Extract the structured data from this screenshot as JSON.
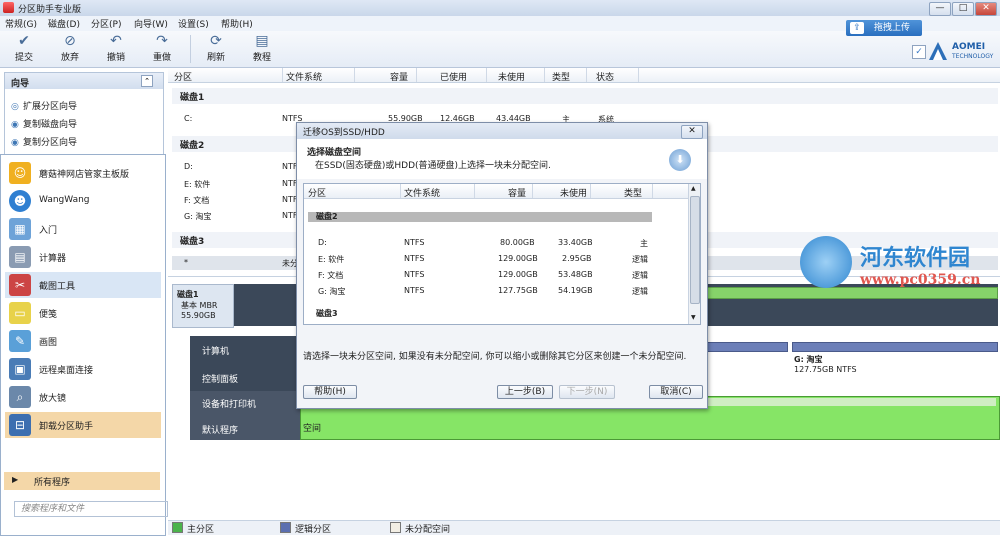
{
  "window": {
    "title": "分区助手专业版",
    "min_label": "—",
    "max_label": "□",
    "close_label": "✕"
  },
  "menu": [
    "常规(G)",
    "磁盘(D)",
    "分区(P)",
    "向导(W)",
    "设置(S)",
    "帮助(H)"
  ],
  "toolbar": {
    "buttons": [
      {
        "label": "提交",
        "icon": "check-icon"
      },
      {
        "label": "放弃",
        "icon": "discard-icon"
      },
      {
        "label": "撤销",
        "icon": "undo-icon"
      },
      {
        "label": "重做",
        "icon": "redo-icon"
      },
      {
        "label": "刷新",
        "icon": "refresh-icon"
      },
      {
        "label": "教程",
        "icon": "tutorial-icon"
      }
    ],
    "upload_label": "拖拽上传",
    "brand": "AOMEI",
    "brand_sub": "TECHNOLOGY"
  },
  "wizard_panel": {
    "title": "向导",
    "items": [
      "扩展分区向导",
      "复制磁盘向导",
      "复制分区向导"
    ]
  },
  "start_menu": {
    "items": [
      "蘑菇神网店管家主板版",
      "WangWang",
      "入门",
      "计算器",
      "截图工具",
      "便笺",
      "画图",
      "远程桌面连接",
      "放大镜",
      "卸载分区助手"
    ],
    "all_programs": "所有程序",
    "search_placeholder": "搜索程序和文件",
    "right_items": [
      "计算机",
      "控制面板",
      "设备和打印机",
      "默认程序"
    ]
  },
  "table": {
    "headers": [
      "分区",
      "文件系统",
      "容量",
      "已使用",
      "未使用",
      "类型",
      "状态"
    ],
    "groups": [
      "磁盘1",
      "磁盘2",
      "磁盘3"
    ],
    "disk1_rows": [
      [
        "C:",
        "NTFS",
        "55.90GB",
        "12.46GB",
        "43.44GB",
        "主",
        "系统"
      ]
    ],
    "disk2_rows": [
      [
        "D:",
        "NTF"
      ],
      [
        "E: 软件",
        "NTF"
      ],
      [
        "F: 文档",
        "NTF"
      ],
      [
        "G: 淘宝",
        "NTF"
      ]
    ],
    "unalloc_row": [
      "*",
      "未分"
    ]
  },
  "diskmap": {
    "disk1_name": "磁盘1",
    "disk1_type": "基本 MBR",
    "disk1_size": "55.90GB",
    "g_label": "G: 淘宝",
    "g_info": "127.75GB NTFS",
    "unalloc_label": "空间"
  },
  "legend": [
    "主分区",
    "逻辑分区",
    "未分配空间"
  ],
  "legend_colors": [
    "#4bb34b",
    "#5b6fb0",
    "#f2eee4"
  ],
  "dialog": {
    "title": "迁移OS到SSD/HDD",
    "close_label": "✕",
    "heading": "选择磁盘空间",
    "subheading": "在SSD(固态硬盘)或HDD(普通硬盘)上选择一块未分配空间.",
    "headers": [
      "分区",
      "文件系统",
      "容量",
      "未使用",
      "类型"
    ],
    "group": "磁盘2",
    "rows": [
      [
        "D:",
        "NTFS",
        "80.00GB",
        "33.40GB",
        "主"
      ],
      [
        "E: 软件",
        "NTFS",
        "129.00GB",
        "2.95GB",
        "逻辑"
      ],
      [
        "F: 文档",
        "NTFS",
        "129.00GB",
        "53.48GB",
        "逻辑"
      ],
      [
        "G: 淘宝",
        "NTFS",
        "127.75GB",
        "54.19GB",
        "逻辑"
      ]
    ],
    "next_group": "磁盘3",
    "note": "请选择一块未分区空间, 如果没有未分配空间, 你可以缩小或删除其它分区来创建一个未分配空间.",
    "buttons": {
      "help": "帮助(H)",
      "prev": "上一步(B)",
      "next": "下一步(N)",
      "cancel": "取消(C)"
    }
  },
  "watermark": {
    "name": "河东软件园",
    "url": "www.pc0359.cn"
  }
}
